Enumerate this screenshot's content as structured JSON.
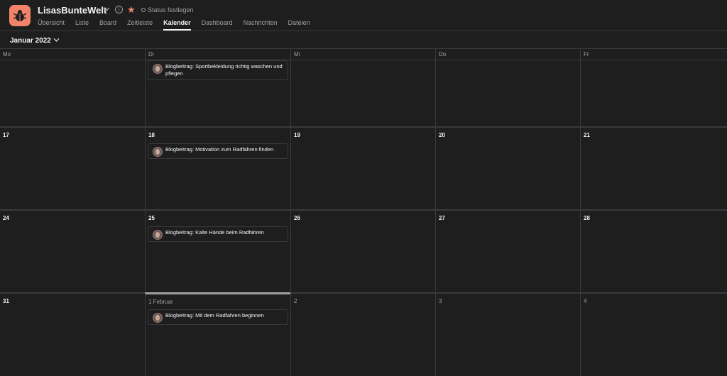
{
  "header": {
    "title": "LisasBunteWelt",
    "info_glyph": "i",
    "star_glyph": "★",
    "status": "Status festlegen",
    "tabs": [
      {
        "label": "Übersicht",
        "active": false
      },
      {
        "label": "Liste",
        "active": false
      },
      {
        "label": "Board",
        "active": false
      },
      {
        "label": "Zeitleiste",
        "active": false
      },
      {
        "label": "Kalender",
        "active": true
      },
      {
        "label": "Dashboard",
        "active": false
      },
      {
        "label": "Nachrichten",
        "active": false
      },
      {
        "label": "Dateien",
        "active": false
      }
    ]
  },
  "toolbar": {
    "month": "Januar 2022"
  },
  "calendar": {
    "weekdays": [
      "Mo",
      "Di",
      "Mi",
      "Do",
      "Fr"
    ],
    "weeks": [
      [
        {
          "date": ""
        },
        {
          "date": "",
          "task": "Blogbeitrag: Sportbekleidung richtig waschen und pflegen"
        },
        {
          "date": ""
        },
        {
          "date": ""
        },
        {
          "date": ""
        }
      ],
      [
        {
          "date": "17"
        },
        {
          "date": "18",
          "task": "Blogbeitrag: Motivation zum Radfahren finden"
        },
        {
          "date": "19"
        },
        {
          "date": "20"
        },
        {
          "date": "21"
        }
      ],
      [
        {
          "date": "24"
        },
        {
          "date": "25",
          "task": "Blogbeitrag: Kalte Hände beim Radfahren"
        },
        {
          "date": "26"
        },
        {
          "date": "27"
        },
        {
          "date": "28"
        }
      ],
      [
        {
          "date": "31"
        },
        {
          "date": "1 Februar",
          "task": "Blogbeitrag: Mit dem Radfahren beginnen",
          "muted": true,
          "today": true
        },
        {
          "date": "2",
          "muted": true
        },
        {
          "date": "3",
          "muted": true
        },
        {
          "date": "4",
          "muted": true
        }
      ]
    ]
  },
  "colors": {
    "background": "#1e1e1f",
    "border": "#3a3a3c",
    "text": "#f5f4f3",
    "muted_text": "#a2a0a2",
    "accent": "#f1836b"
  },
  "icons": [
    "project-icon",
    "chevron-down-icon",
    "info-icon",
    "star-icon",
    "status-dot-icon",
    "avatar"
  ]
}
